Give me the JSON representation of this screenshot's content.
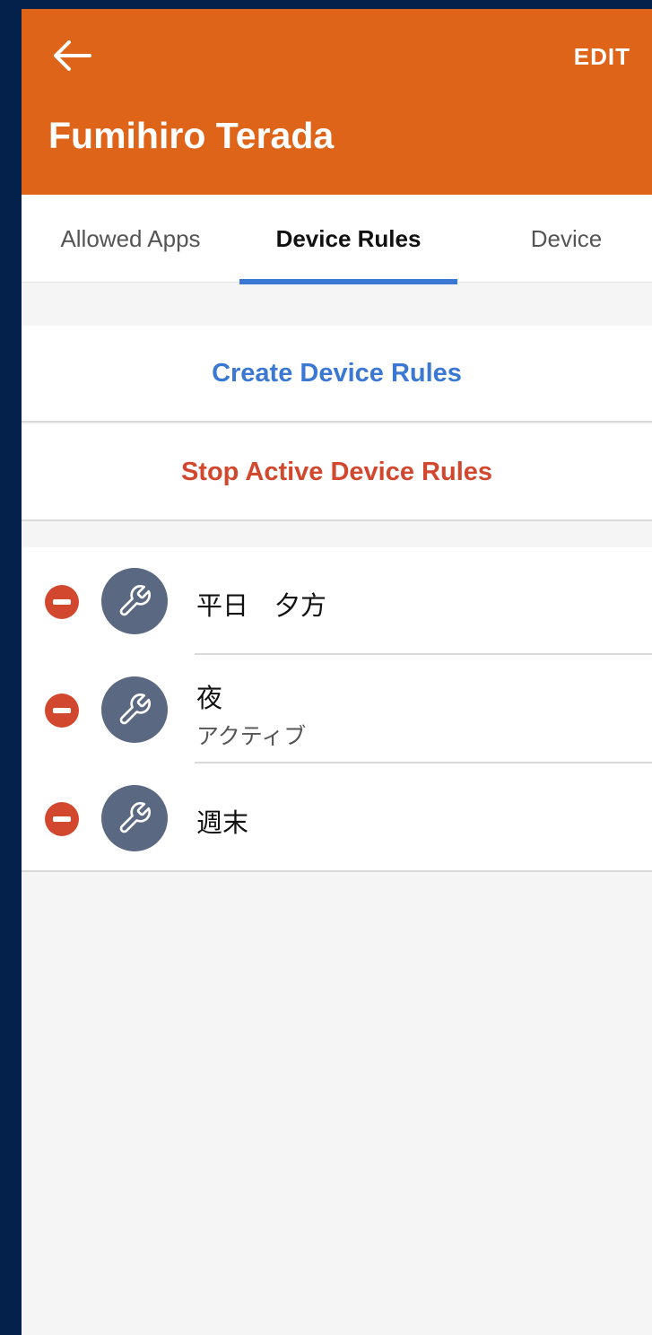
{
  "header": {
    "title": "Fumihiro Terada",
    "edit_label": "EDIT",
    "back_icon": "arrow-left-icon",
    "background_color": "#de6419"
  },
  "tabs": [
    {
      "label": "Allowed Apps",
      "selected": false
    },
    {
      "label": "Device Rules",
      "selected": true
    },
    {
      "label": "Device",
      "selected": false
    }
  ],
  "actions": {
    "create_label": "Create Device Rules",
    "stop_label": "Stop Active Device Rules",
    "create_color": "#3a78d4",
    "stop_color": "#d2482f"
  },
  "rules": [
    {
      "title": "平日　夕方",
      "status": "",
      "icon": "wrench-icon"
    },
    {
      "title": "夜",
      "status": "アクティブ",
      "icon": "wrench-icon"
    },
    {
      "title": "週末",
      "status": "",
      "icon": "wrench-icon"
    }
  ]
}
